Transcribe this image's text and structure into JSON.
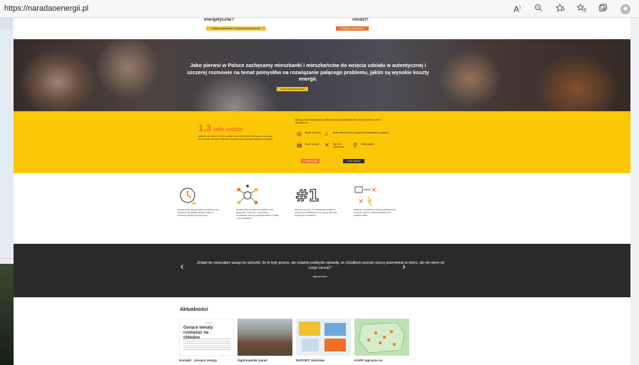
{
  "browser": {
    "url": "https://naradaoenergii.pl",
    "icons": [
      "read-aloud-icon",
      "zoom-icon",
      "add-favorite-icon",
      "favorites-icon",
      "collections-icon",
      "profile-icon"
    ]
  },
  "top": {
    "left_question": "energetyczne?",
    "right_question": "chodzi?",
    "left_button": "POZNAJ PROBLEMY Z WIELKIMI RACHUNKAMI",
    "right_button": "DOWIEDZ SIĘ WIĘCEJ"
  },
  "hero": {
    "text": "Jako pierwsi w Polsce zachęcamy mieszkanki i mieszkańców do wzięcia udziału w autentycznej i szczerej rozmowie na temat pomysłów na rozwiązanie palącego problemu, jakim są wysokie koszty energii.",
    "button": "NASZE ZOBOWIĄZANIE"
  },
  "stats": {
    "number": "1,3",
    "unit": "mln rodzin",
    "description": "Właśnie tyle rodzin w Polsce wydaje ponad 10% swoich dochodów na energię. Rozwiązanie problemu ubóstwa energetycznego wymaga wspólnego działania.",
    "right_intro": "Sprawy, które wpływają na problemy w gospodarstwach domowych w Polsce w tym obszarze to:",
    "items": [
      {
        "icon": "coin-icon",
        "label": "Niskie dochody"
      },
      {
        "icon": "house-icon",
        "label": "Niska efektywność energetyczna budynków i urządzeń"
      },
      {
        "icon": "bill-icon",
        "label": "Koszt energii"
      },
      {
        "icon": "tools-icon",
        "label": "Zły stan techniczny"
      },
      {
        "icon": "magnifier-icon",
        "label": "Brak wiedzy"
      }
    ],
    "button_left": "O PROBLEMIE",
    "button_right": "NASZ WIDOK"
  },
  "steps": [
    {
      "icon": "clock-icon",
      "text": "Narada służy wypracowaniu wspólnej mapy drogowej dla działań polskich władz w obszarze polityki energetycznej"
    },
    {
      "icon": "network-icon",
      "text": "Narada była prowadzona lokalnie przez ekspertów, instytucje, organizacje i środowiska, które są zaangażowane w walkę z tym zjawiskiem"
    },
    {
      "icon": "rank-icon",
      "text": "Zebrane pomysły na rozwiązanie problemu zostaną przedstawione przez grupy jako lista wybranych Postulatów"
    },
    {
      "icon": "decision-icon",
      "text": "Wybrane rozwiązania zostaną opublikowane w formie raportu z rekomendacjami dla polskich władz"
    }
  ],
  "steps_button": "DOWIEDZ SIĘ WIĘCEJ",
  "quote": {
    "text": "„Dotąd nie zwracałam uwagi na rachunki, bo to były grosze, ale ostatnie podwyżki sprawiły, że chciałbym poznać rzeczy pozmieniać w domu, ale nie wiem od czego zacząć!”",
    "author": "MIESZKANKA"
  },
  "news": {
    "title": "Aktualności",
    "cards": [
      {
        "title": "Kontakt: „Gorące tematy",
        "headline": "Gorące tematy rozważać na chłodno"
      },
      {
        "title": "Ogólnopolski panel"
      },
      {
        "title": "RAPORT: Ubóstwo"
      },
      {
        "title": "KAPE zaprasza na"
      }
    ]
  },
  "colors": {
    "yellow": "#fbc707",
    "orange": "#f27023",
    "dark": "#2a2a2a"
  }
}
